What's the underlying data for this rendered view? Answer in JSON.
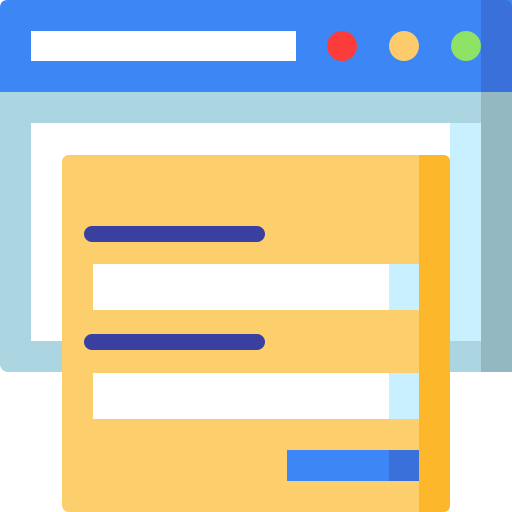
{
  "illustration": {
    "subject": "web-form-window-icon",
    "colors": {
      "window_frame": "#ABD5E0",
      "window_frame_shade": "#93B8C1",
      "title_bar": "#3C87F5",
      "title_bar_shade": "#3A70DA",
      "address_field": "#FFFFFF",
      "viewport": "#FFFFFF",
      "viewport_edge": "#C9F0FE",
      "dot_red": "#FC3B3B",
      "dot_yellow": "#FDCB6C",
      "dot_green": "#8EE266",
      "form_card": "#FDCE6C",
      "form_card_shade": "#FDB72A",
      "form_label": "#3A40A0",
      "input_field": "#FFFFFF",
      "input_field_edge": "#C9F0FE",
      "submit_button": "#3C87F5",
      "submit_button_shade": "#3A70DA"
    },
    "window_controls": [
      "red-dot",
      "yellow-dot",
      "green-dot"
    ],
    "form_fields": [
      "field-1",
      "field-2"
    ]
  }
}
